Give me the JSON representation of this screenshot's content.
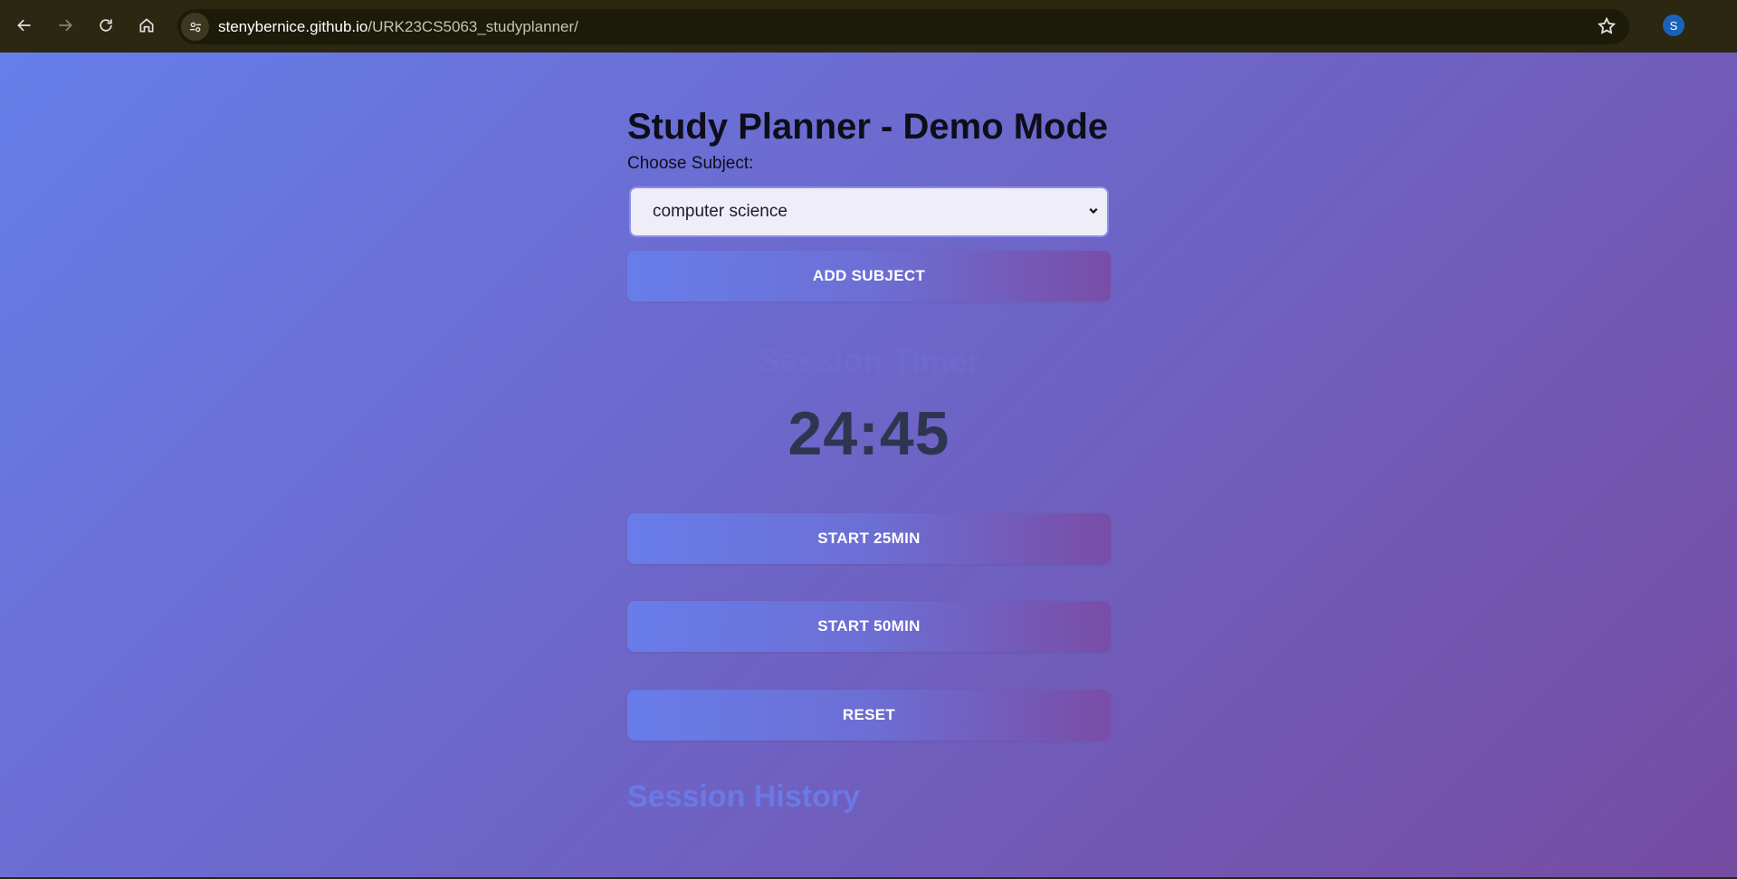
{
  "browser": {
    "url_host": "stenybernice.github.io",
    "url_path": "/URK23CS5063_studyplanner/",
    "profile_initial": "S"
  },
  "page": {
    "title": "Study Planner - Demo Mode",
    "choose_label": "Choose Subject:",
    "selected_subject": "computer science",
    "add_subject_label": "ADD SUBJECT",
    "timer_heading": "Session Timer",
    "timer_value": "24:45",
    "start25_label": "START 25MIN",
    "start50_label": "START 50MIN",
    "reset_label": "RESET",
    "history_heading": "Session History"
  },
  "colors": {
    "gradient_start": "#667eea",
    "gradient_end": "#764ba2",
    "chrome_bg": "#2b2710"
  }
}
